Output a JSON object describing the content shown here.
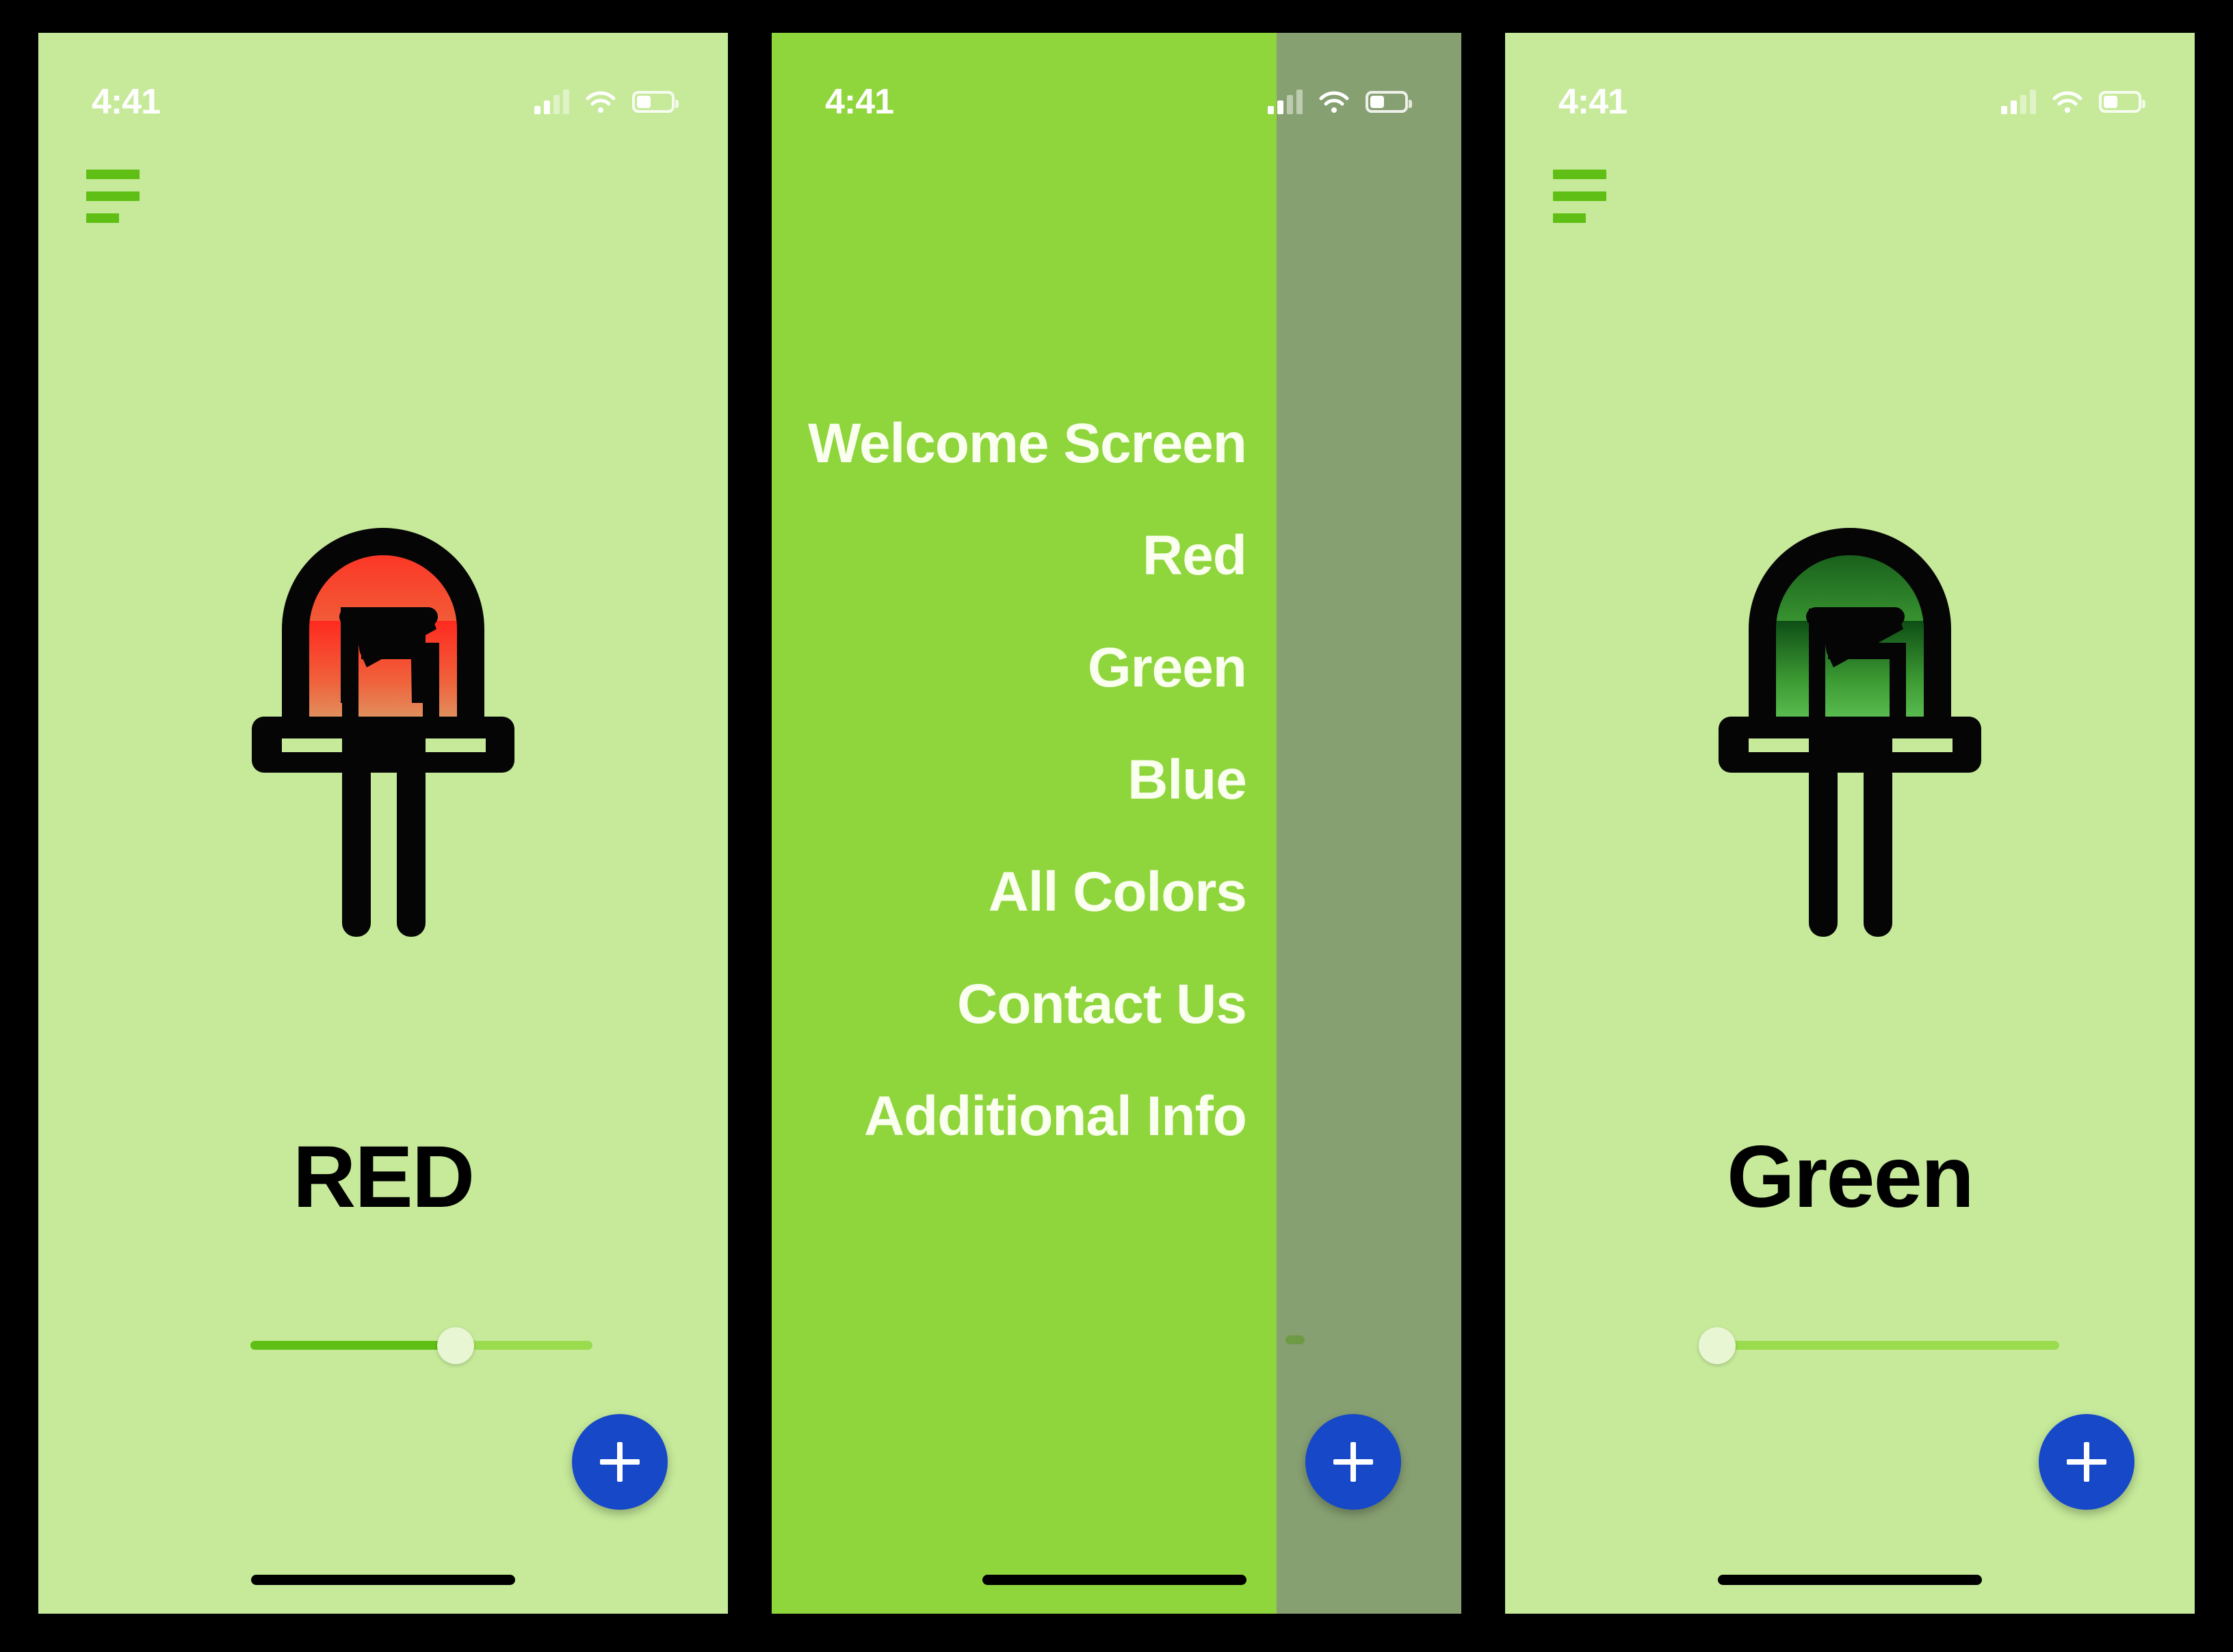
{
  "app": {
    "background_color": "#C6EA9A",
    "drawer_color": "#8FD53C",
    "scrim_color": "#87A072",
    "fab_color": "#1648C8",
    "accent_green": "#5FBF15",
    "track_green": "#9BDC4E",
    "thumb_color": "#E9F6D4"
  },
  "status_bar": {
    "time": "4:41",
    "signal_icon": "cellular-signal-icon",
    "wifi_icon": "wifi-icon",
    "battery_icon": "battery-icon"
  },
  "icons": {
    "menu": "hamburger-menu-icon",
    "led": "led-bulb-icon",
    "plus": "plus-icon",
    "home": "home-indicator"
  },
  "screens": [
    {
      "id": "red-screen",
      "label": "RED",
      "led_gradient_from": "#FF2A1F",
      "led_gradient_to": "#DCA06A",
      "slider_value": 60,
      "fab_label": "+"
    },
    {
      "id": "drawer-screen",
      "label": "",
      "fab_label": "+"
    },
    {
      "id": "green-screen",
      "label": "Green",
      "led_gradient_from": "#0E4E16",
      "led_gradient_to": "#62C65A",
      "slider_value": 0,
      "fab_label": "+"
    }
  ],
  "drawer": {
    "items": [
      {
        "label": "Welcome Screen"
      },
      {
        "label": "Red"
      },
      {
        "label": "Green"
      },
      {
        "label": "Blue"
      },
      {
        "label": "All Colors"
      },
      {
        "label": "Contact Us"
      },
      {
        "label": "Additional Info"
      }
    ]
  }
}
